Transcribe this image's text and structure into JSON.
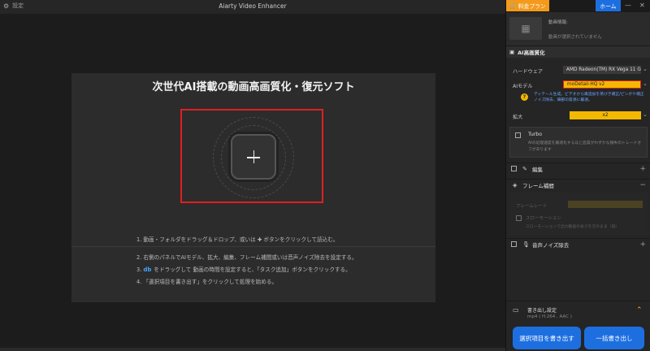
{
  "titlebar": {
    "settings_label": "設定",
    "app_title": "Aiarty Video Enhancer"
  },
  "main": {
    "card_title": "次世代AI搭載の動画高画質化・復元ソフト",
    "instructions": [
      "1.  動画・フォルダをドラッグ＆ドロップ、或いは ✚ ボタンをクリックして読込む。",
      "2.  右側のパネルでAIモデル、拡大、編集、フレーム補間或いは音声ノイズ除去を設定する。",
      "3.  をドラッグして 動画の時間を設定すると、「タスク追加」ボタンをクリックする。",
      "4.  「選択項目を書き出す」をクリックして処理を始める。"
    ],
    "db_icon_text": "db"
  },
  "right": {
    "plan_label": "料金プラン",
    "home_label": "ホーム",
    "media_info_title": "動画情報:",
    "media_info_empty": "動画が選択されていません",
    "ai_section_title": "AI高画質化",
    "hardware_label": "ハードウェア",
    "hardware_value": "AMD Radeon(TM) RX Vega 11 G",
    "model_label": "AIモデル",
    "model_value": "moDetail-HQ  v2",
    "model_note": "ディテール生成。ビデオから再追加を帯びき補正/ピンボケ補正ノイズ除去、細部の質感に最適。",
    "scale_label": "拡大",
    "scale_value": "x2",
    "turbo_label": "Turbo",
    "turbo_note": "AIの処理速度を最適化するほど品質がわずかな損失のトレードオフがあります",
    "edit_label": "編集",
    "frame_interp_label": "フレーム補間",
    "frame_rate_label": "フレームレート",
    "slow_motion_label": "スローモーション",
    "slow_motion_note": "スローモーションで出力動画の長さを元のまま（倍）",
    "audio_denoise_label": "音声ノイズ除去",
    "output_settings_title": "書き出し設定",
    "output_settings_value": "mp4 ( H.264 , AAC )",
    "export_selected_label": "選択項目を書き出す",
    "export_all_label": "一括書き出し"
  },
  "colors": {
    "highlight_red": "#e01f1f",
    "accent_blue": "#1d6fe0",
    "plan_orange": "#f39a1c",
    "field_yellow": "#f5b800"
  }
}
